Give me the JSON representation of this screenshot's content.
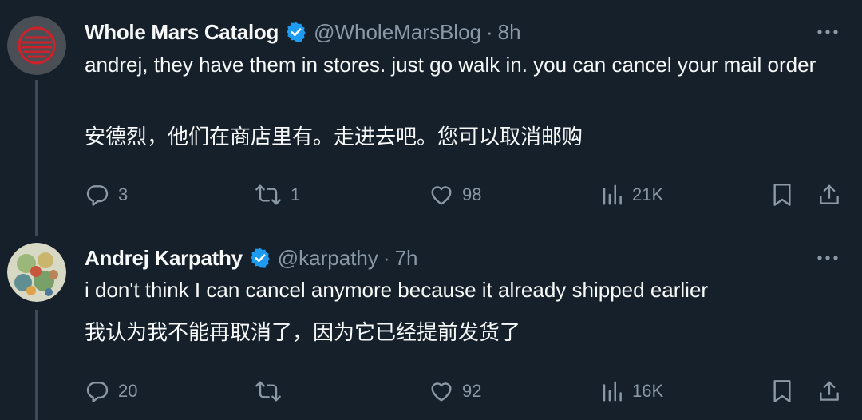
{
  "tweets": [
    {
      "name": "Whole Mars Catalog",
      "handle": "@WholeMarsBlog",
      "separator": "·",
      "time": "8h",
      "text": "andrej, they have them in stores. just go walk in. you can cancel your mail order",
      "translation": "安德烈，他们在商店里有。走进去吧。您可以取消邮购",
      "replies": "3",
      "reposts": "1",
      "likes": "98",
      "views": "21K"
    },
    {
      "name": "Andrej Karpathy",
      "handle": "@karpathy",
      "separator": "·",
      "time": "7h",
      "text": "i don't think I can cancel anymore because it already shipped earlier",
      "translation": "我认为我不能再取消了，因为它已经提前发货了",
      "replies": "20",
      "reposts": "",
      "likes": "92",
      "views": "16K"
    }
  ],
  "colors": {
    "background": "#15202b",
    "text": "#f7f9f9",
    "muted": "#8b98a5",
    "verified": "#1d9bf0",
    "thread_line": "#3d4a57"
  },
  "icons": [
    "verified-badge-icon",
    "more-icon",
    "reply-icon",
    "repost-icon",
    "like-icon",
    "views-icon",
    "bookmark-icon",
    "share-icon"
  ]
}
